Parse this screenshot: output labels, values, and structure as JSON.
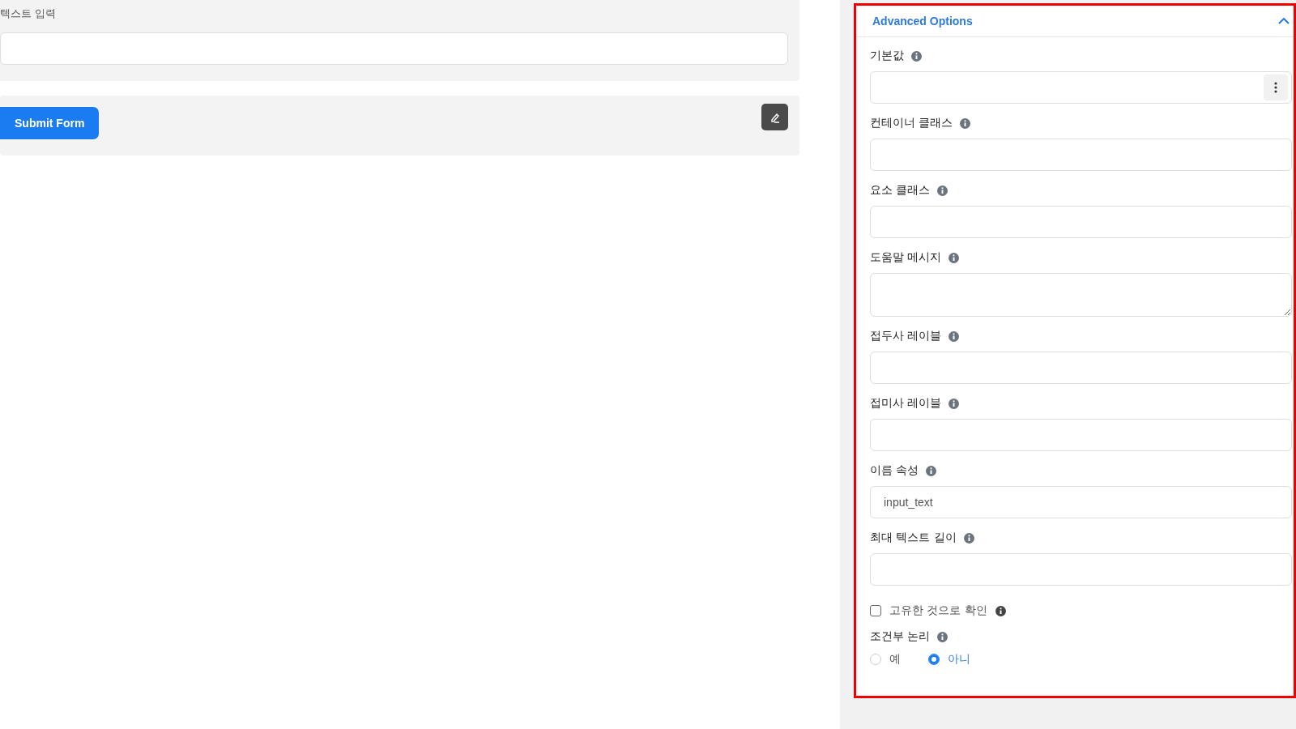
{
  "form_preview": {
    "field_label": "텍스트 입력",
    "submit_button": "Submit Form"
  },
  "advanced_options": {
    "title": "Advanced Options",
    "expanded": true,
    "fields": [
      {
        "kind": "text",
        "label": "기본값",
        "has_menu": true
      },
      {
        "kind": "text",
        "label": "컨테이너 클래스"
      },
      {
        "kind": "text",
        "label": "요소 클래스"
      },
      {
        "kind": "textarea",
        "label": "도움말 메시지"
      },
      {
        "kind": "text",
        "label": "접두사 레이블"
      },
      {
        "kind": "text",
        "label": "접미사 레이블"
      },
      {
        "kind": "text",
        "label": "이름 속성",
        "value": "input_text"
      },
      {
        "kind": "text",
        "label": "최대 텍스트 길이"
      },
      {
        "kind": "checkbox",
        "label": "고유한 것으로 확인",
        "checked": false
      },
      {
        "kind": "radio",
        "label": "조건부 논리",
        "options": [
          {
            "label": "예",
            "selected": false
          },
          {
            "label": "아니",
            "selected": true
          }
        ]
      }
    ]
  }
}
